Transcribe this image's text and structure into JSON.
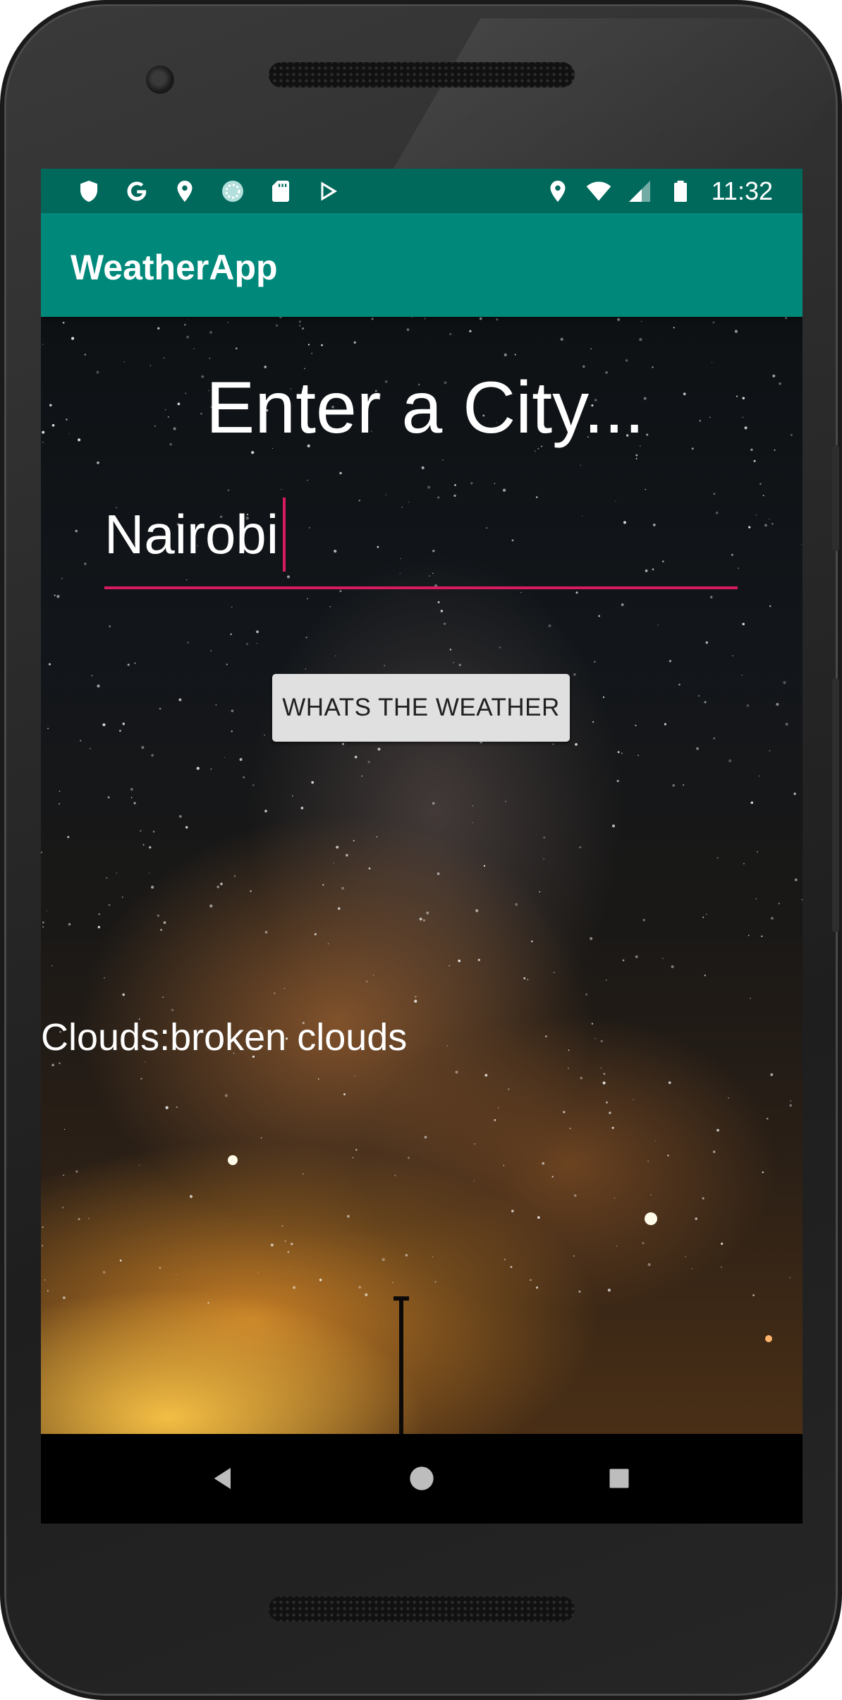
{
  "status_bar": {
    "left_icons": [
      "shield-icon",
      "google-g-icon",
      "location-pin-icon",
      "sync-circle-icon",
      "sd-card-icon",
      "play-store-icon"
    ],
    "right_icons": [
      "location-pin-icon",
      "wifi-icon",
      "cell-signal-icon",
      "battery-icon"
    ],
    "time": "11:32"
  },
  "app_bar": {
    "title": "WeatherApp"
  },
  "main": {
    "headline": "Enter a City...",
    "city_input": {
      "value": "Nairobi"
    },
    "weather_button_label": "WHATS THE WEATHER",
    "result_text": "Clouds:broken clouds"
  },
  "nav_bar": {
    "buttons": [
      "back-icon",
      "home-icon",
      "recents-icon"
    ]
  },
  "colors": {
    "status_bar": "#00695c",
    "app_bar": "#00897b",
    "accent": "#d81b60",
    "button_bg": "#e0e0e0"
  }
}
